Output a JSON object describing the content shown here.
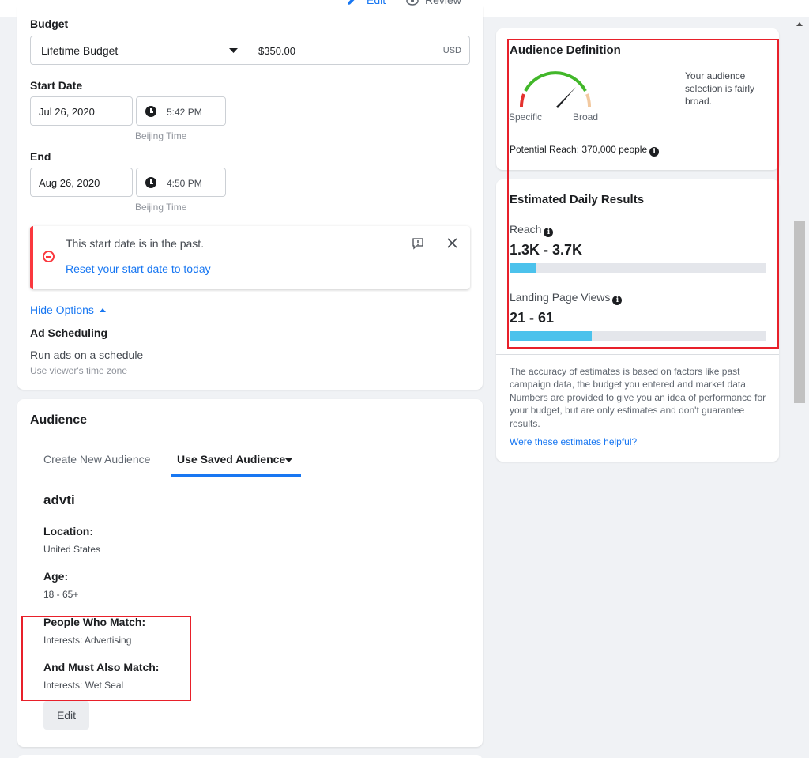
{
  "tabs": {
    "edit": "Edit",
    "review": "Review"
  },
  "budget": {
    "label": "Budget",
    "type": "Lifetime Budget",
    "amount": "$350.00",
    "currency": "USD"
  },
  "start": {
    "label": "Start Date",
    "date": "Jul 26, 2020",
    "time": "5:42 PM",
    "tz": "Beijing Time"
  },
  "end": {
    "label": "End",
    "date": "Aug 26, 2020",
    "time": "4:50 PM",
    "tz": "Beijing Time"
  },
  "alert": {
    "message": "This start date is in the past.",
    "link": "Reset your start date to today"
  },
  "options": {
    "hide_link": "Hide Options",
    "ad_scheduling": "Ad Scheduling",
    "schedule_text": "Run ads on a schedule",
    "schedule_sub": "Use viewer's time zone"
  },
  "audience": {
    "title": "Audience",
    "tab_create": "Create New Audience",
    "tab_saved": "Use Saved Audience",
    "name": "advti",
    "location_label": "Location:",
    "location_value": "United States",
    "age_label": "Age:",
    "age_value": "18 - 65+",
    "match_label": "People Who Match:",
    "match_value": "Interests: Advertising",
    "also_label": "And Must Also Match:",
    "also_value": "Interests: Wet Seal",
    "edit_button": "Edit"
  },
  "definition": {
    "title": "Audience Definition",
    "specific": "Specific",
    "broad": "Broad",
    "description": "Your audience selection is fairly broad.",
    "reach": "Potential Reach: 370,000 people"
  },
  "estimates": {
    "title": "Estimated Daily Results",
    "reach_label": "Reach",
    "reach_value": "1.3K - 3.7K",
    "reach_fill": 0.1,
    "lpv_label": "Landing Page Views",
    "lpv_value": "21 - 61",
    "lpv_fill": 0.32,
    "disclaimer": "The accuracy of estimates is based on factors like past campaign data, the budget you entered and market data. Numbers are provided to give you an idea of performance for your budget, but are only estimates and don't guarantee results.",
    "helpful_link": "Were these estimates helpful?"
  },
  "colors": {
    "accent": "#1877f2",
    "alert_red": "#fa383e",
    "highlight_red": "#e8202a",
    "bar_fill": "#4cc2ec"
  },
  "icons": [
    "pencil-icon",
    "eye-icon",
    "caret-down-icon",
    "clock-icon",
    "error-icon",
    "feedback-icon",
    "close-icon",
    "info-icon",
    "gauge-icon"
  ]
}
